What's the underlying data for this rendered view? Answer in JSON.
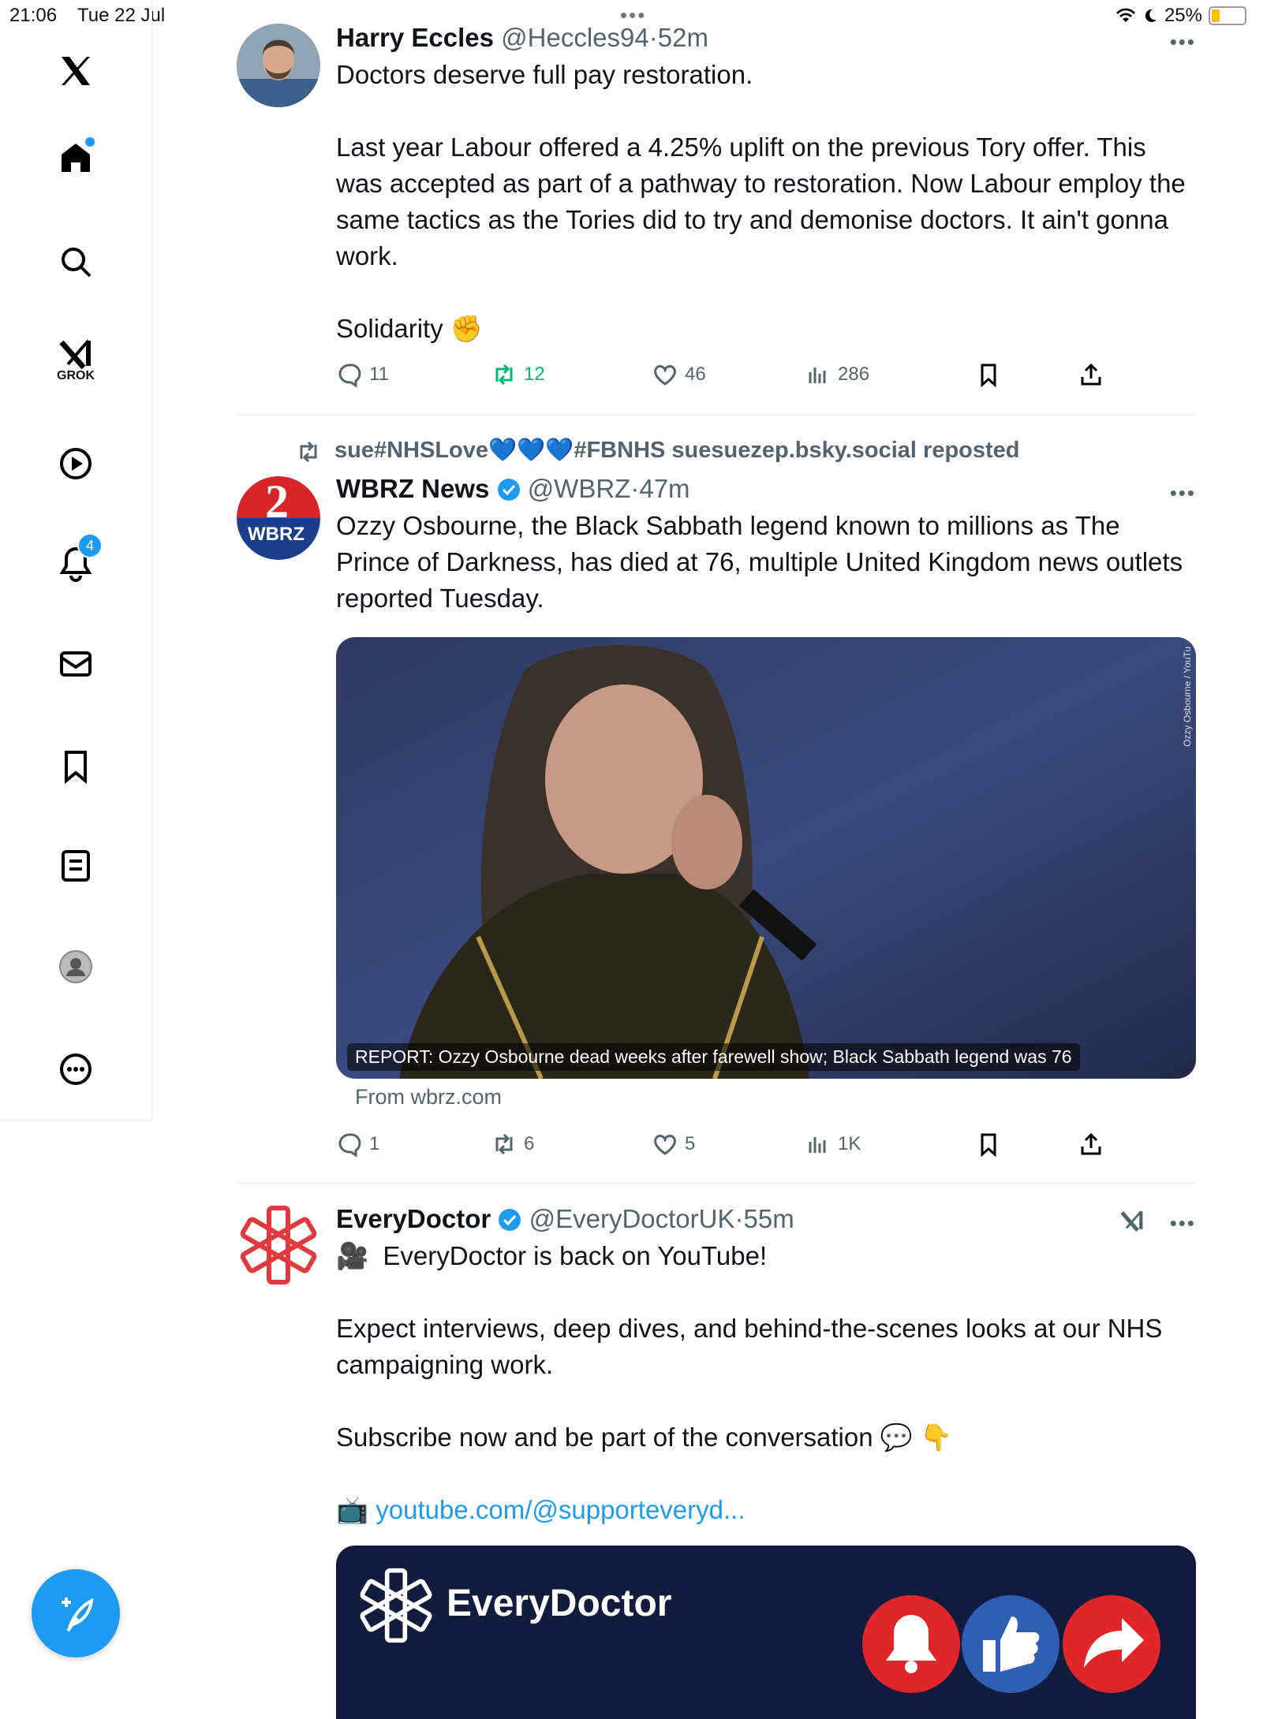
{
  "status": {
    "time": "21:06",
    "date": "Tue 22 Jul",
    "battery": "25%",
    "battery_level": 0.25
  },
  "sidebar": {
    "grok_label": "GROK",
    "notifications_count": "4",
    "items": [
      "x-logo",
      "home",
      "search",
      "grok",
      "video",
      "notifications",
      "messages",
      "bookmarks",
      "lists",
      "profile",
      "more"
    ]
  },
  "tweets": [
    {
      "name": "Harry Eccles",
      "handle": "@Heccles94",
      "time": "52m",
      "text": "Doctors deserve full pay restoration.\n\nLast year Labour offered a 4.25% uplift on the previous Tory offer. This was accepted as part of a pathway to restoration. Now Labour employ the same tactics as the Tories did to try and demonise doctors. It ain't gonna work.\n\nSolidarity ✊",
      "replies": "11",
      "reposts": "12",
      "likes": "46",
      "views": "286"
    },
    {
      "repost_by": "sue#NHSLove💙💙💙#FBNHS suesuezep.bsky.social reposted",
      "name": "WBRZ News",
      "handle": "@WBRZ",
      "time": "47m",
      "avatar_label": "WBRZ",
      "avatar_num": "2",
      "text": "Ozzy Osbourne, the Black Sabbath legend known to millions as The Prince of Darkness, has died at 76, multiple United Kingdom news outlets reported Tuesday.",
      "card_caption": "REPORT: Ozzy Osbourne dead weeks after farewell show; Black Sabbath legend was 76",
      "card_credit": "Ozzy Osbourne / YouTu",
      "card_source": "From wbrz.com",
      "replies": "1",
      "reposts": "6",
      "likes": "5",
      "views": "1K"
    },
    {
      "name": "EveryDoctor",
      "handle": "@EveryDoctorUK",
      "time": "55m",
      "text1": "🎥  EveryDoctor is back on YouTube!\n\nExpect interviews, deep dives, and behind-the-scenes looks at our NHS campaigning work.\n\nSubscribe now and be part of the conversation 💬 👇\n\n",
      "link_icon": "📺",
      "link": "youtube.com/@supporteveryd...",
      "card_title": "EveryDoctor"
    }
  ],
  "colors": {
    "accent": "#1d9bf0",
    "repost_active": "#00ba7c",
    "muted": "#536471",
    "everydoctor_red": "#e03a3e",
    "card_navy": "#101b3d"
  }
}
